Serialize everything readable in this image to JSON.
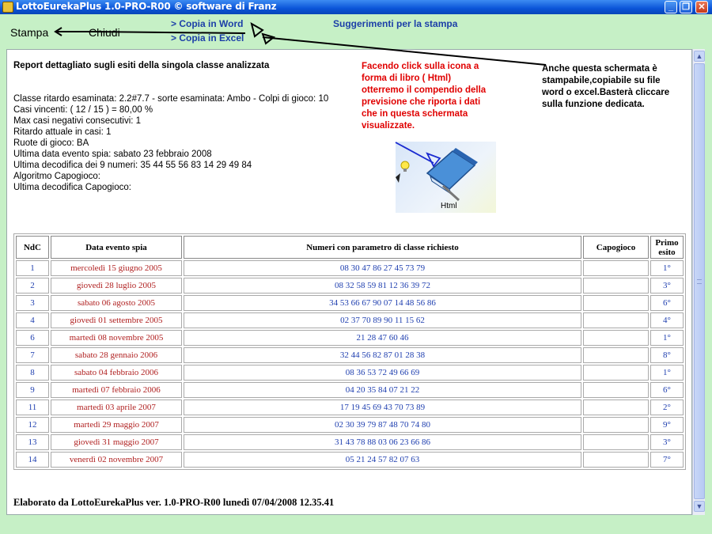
{
  "window": {
    "title": "LottoEurekaPlus 1.0-PRO-R00    © software di Franz",
    "min_label": "_",
    "max_label": "❐",
    "close_label": "✕"
  },
  "toolbar": {
    "print_label": "Stampa",
    "close_label": "Chiudi",
    "copy_word_label": "> Copia in Word",
    "copy_excel_label": "> Copia in Excel",
    "print_tips_label": "Suggerimenti per la stampa"
  },
  "report": {
    "title": "Report dettagliato sugli esiti della singola classe analizzata",
    "lines": [
      "Classe ritardo esaminata: 2.2#7.7 - sorte esaminata: Ambo - Colpi di gioco: 10",
      "Casi vincenti: ( 12 / 15 ) = 80,00 %",
      "Max casi negativi consecutivi: 1",
      "Ritardo attuale in casi: 1",
      "Ruote di gioco: BA",
      "Ultima data evento spia: sabato 23 febbraio 2008",
      "Ultima decodifica dei 9 numeri: 35 44 55 56 83 14 29 49 84",
      "Algoritmo Capogioco:",
      "Ultima decodifica Capogioco:"
    ]
  },
  "notes": {
    "red": "Facendo click sulla icona a forma di libro ( Html) otterremo il compendio della previsione che riporta i dati che in questa schermata visualizzate.",
    "black": "Anche questa schermata è stampabile,copiabile su file word o excel.Basterà cliccare sulla funzione dedicata."
  },
  "html_icon": {
    "label": "Html",
    "icon_name": "book-icon"
  },
  "table": {
    "headers": [
      "NdC",
      "Data evento spia",
      "Numeri con parametro di classe richiesto",
      "Capogioco",
      "Primo esito"
    ],
    "rows": [
      {
        "ndc": "1",
        "date": "mercoledì 15 giugno 2005",
        "numbers": "08 30 47 86 27 45 73 79",
        "capo": "",
        "esito": "1°"
      },
      {
        "ndc": "2",
        "date": "giovedì 28 luglio 2005",
        "numbers": "08 32 58 59 81 12 36 39 72",
        "capo": "",
        "esito": "3°"
      },
      {
        "ndc": "3",
        "date": "sabato 06 agosto 2005",
        "numbers": "34 53 66 67 90 07 14 48 56 86",
        "capo": "",
        "esito": "6°"
      },
      {
        "ndc": "4",
        "date": "giovedì 01 settembre 2005",
        "numbers": "02 37 70 89 90 11 15 62",
        "capo": "",
        "esito": "4°"
      },
      {
        "ndc": "6",
        "date": "martedì 08 novembre 2005",
        "numbers": "21 28 47 60 46",
        "capo": "",
        "esito": "1°"
      },
      {
        "ndc": "7",
        "date": "sabato 28 gennaio 2006",
        "numbers": "32 44 56 82 87 01 28 38",
        "capo": "",
        "esito": "8°"
      },
      {
        "ndc": "8",
        "date": "sabato 04 febbraio 2006",
        "numbers": "08 36 53 72 49 66 69",
        "capo": "",
        "esito": "1°"
      },
      {
        "ndc": "9",
        "date": "martedì 07 febbraio 2006",
        "numbers": "04 20 35 84 07 21 22",
        "capo": "",
        "esito": "6°"
      },
      {
        "ndc": "11",
        "date": "martedì 03 aprile 2007",
        "numbers": "17 19 45 69 43 70 73 89",
        "capo": "",
        "esito": "2°"
      },
      {
        "ndc": "12",
        "date": "martedì 29 maggio 2007",
        "numbers": "02 30 39 79 87 48 70 74 80",
        "capo": "",
        "esito": "9°"
      },
      {
        "ndc": "13",
        "date": "giovedì 31 maggio 2007",
        "numbers": "31 43 78 88 03 06 23 66 86",
        "capo": "",
        "esito": "3°"
      },
      {
        "ndc": "14",
        "date": "venerdì 02 novembre 2007",
        "numbers": "05 21 24 57 82 07 63",
        "capo": "",
        "esito": "7°"
      }
    ]
  },
  "footer": {
    "text": "Elaborato da LottoEurekaPlus ver. 1.0-PRO-R00  lunedì 07/04/2008 12.35.41"
  },
  "colors": {
    "background": "#c6f0c6",
    "link_blue": "#1c3fa8",
    "note_red": "#e00000",
    "date_red": "#b02020",
    "number_blue": "#2040b0"
  }
}
